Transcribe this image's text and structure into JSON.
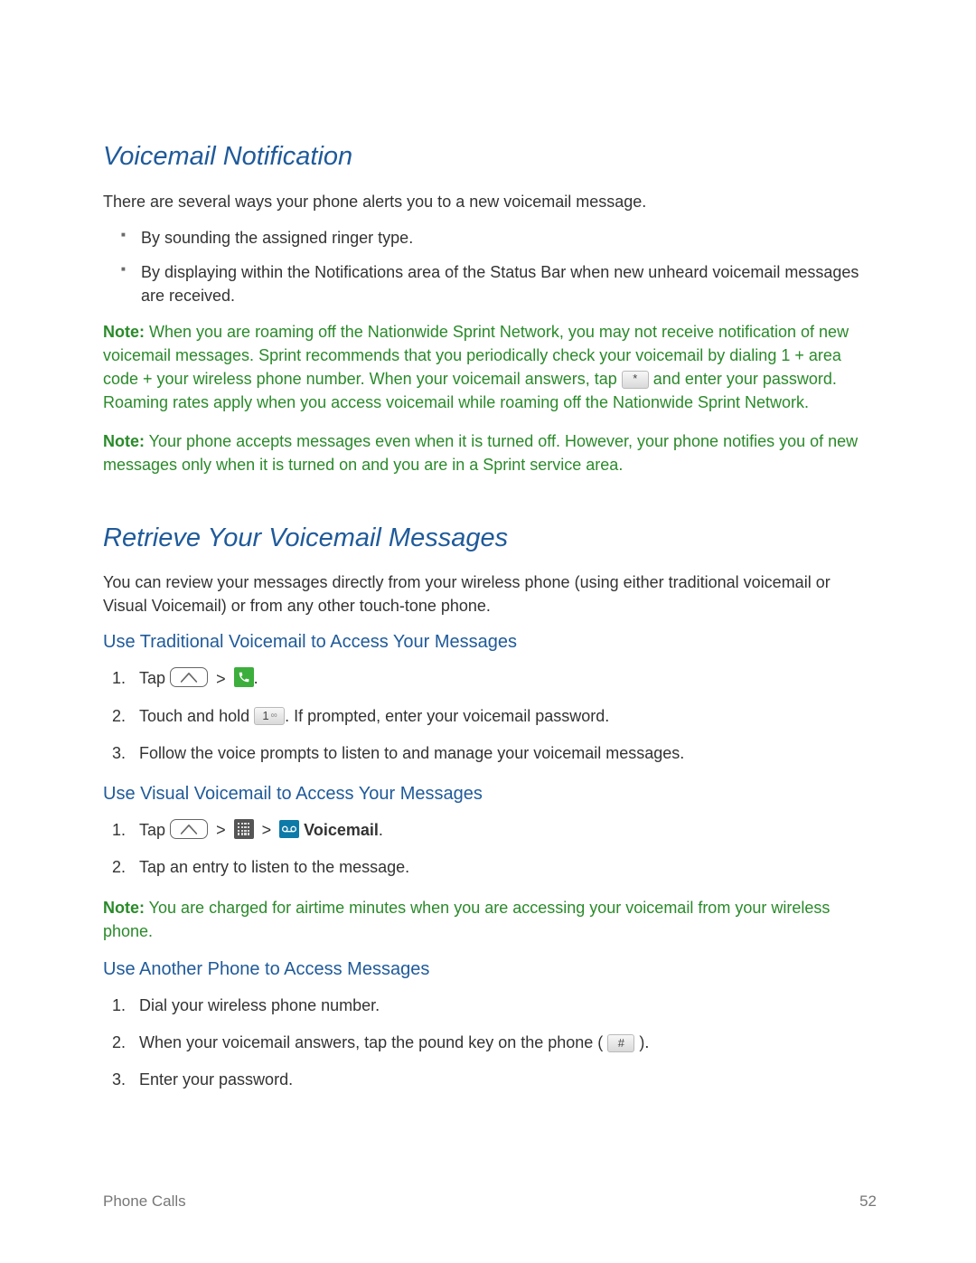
{
  "section1": {
    "heading": "Voicemail Notification",
    "intro": "There are several ways your phone alerts you to a new voicemail message.",
    "bullets": [
      "By sounding the assigned ringer type.",
      "By displaying within the Notifications area of the Status Bar when new unheard voicemail messages are received."
    ],
    "note1": {
      "label": "Note:",
      "before_key": " When you are roaming off the Nationwide Sprint Network, you may not receive notification of new voicemail messages. Sprint recommends that you periodically check your voicemail by dialing 1 + area code + your wireless phone number. When your voicemail answers, tap ",
      "after_key": " and enter your password. Roaming rates apply when you access voicemail while roaming off the Nationwide Sprint Network."
    },
    "note2": {
      "label": "Note:",
      "text": " Your phone accepts messages even when it is turned off. However, your phone notifies you of new messages only when it is turned on and you are in a Sprint service area."
    }
  },
  "section2": {
    "heading": "Retrieve Your Voicemail Messages",
    "intro": "You can review your messages directly from your wireless phone (using either traditional voicemail or Visual Voicemail) or from any other touch-tone phone.",
    "sub1": {
      "heading": "Use Traditional Voicemail to Access Your Messages",
      "step1_prefix": "Tap",
      "step1_suffix": ".",
      "step2_prefix": "Touch and hold ",
      "step2_suffix": ". If prompted, enter your voicemail password.",
      "step3": "Follow the voice prompts to listen to and manage your voicemail messages."
    },
    "sub2": {
      "heading": "Use Visual Voicemail to Access Your Messages",
      "step1_prefix": "Tap",
      "step1_bold": "Voicemail",
      "step1_suffix": ".",
      "step2": "Tap an entry to listen to the message."
    },
    "note3": {
      "label": "Note:",
      "text": " You are charged for airtime minutes when you are accessing your voicemail from your wireless phone."
    },
    "sub3": {
      "heading": "Use Another Phone to Access Messages",
      "step1": "Dial your wireless phone number.",
      "step2_prefix": "When your voicemail answers, tap the pound key on the phone (",
      "step2_suffix": ").",
      "step3": "Enter your password."
    }
  },
  "keys": {
    "star": "*",
    "one": "1",
    "hash": "#"
  },
  "footer": {
    "left": "Phone Calls",
    "right": "52"
  }
}
